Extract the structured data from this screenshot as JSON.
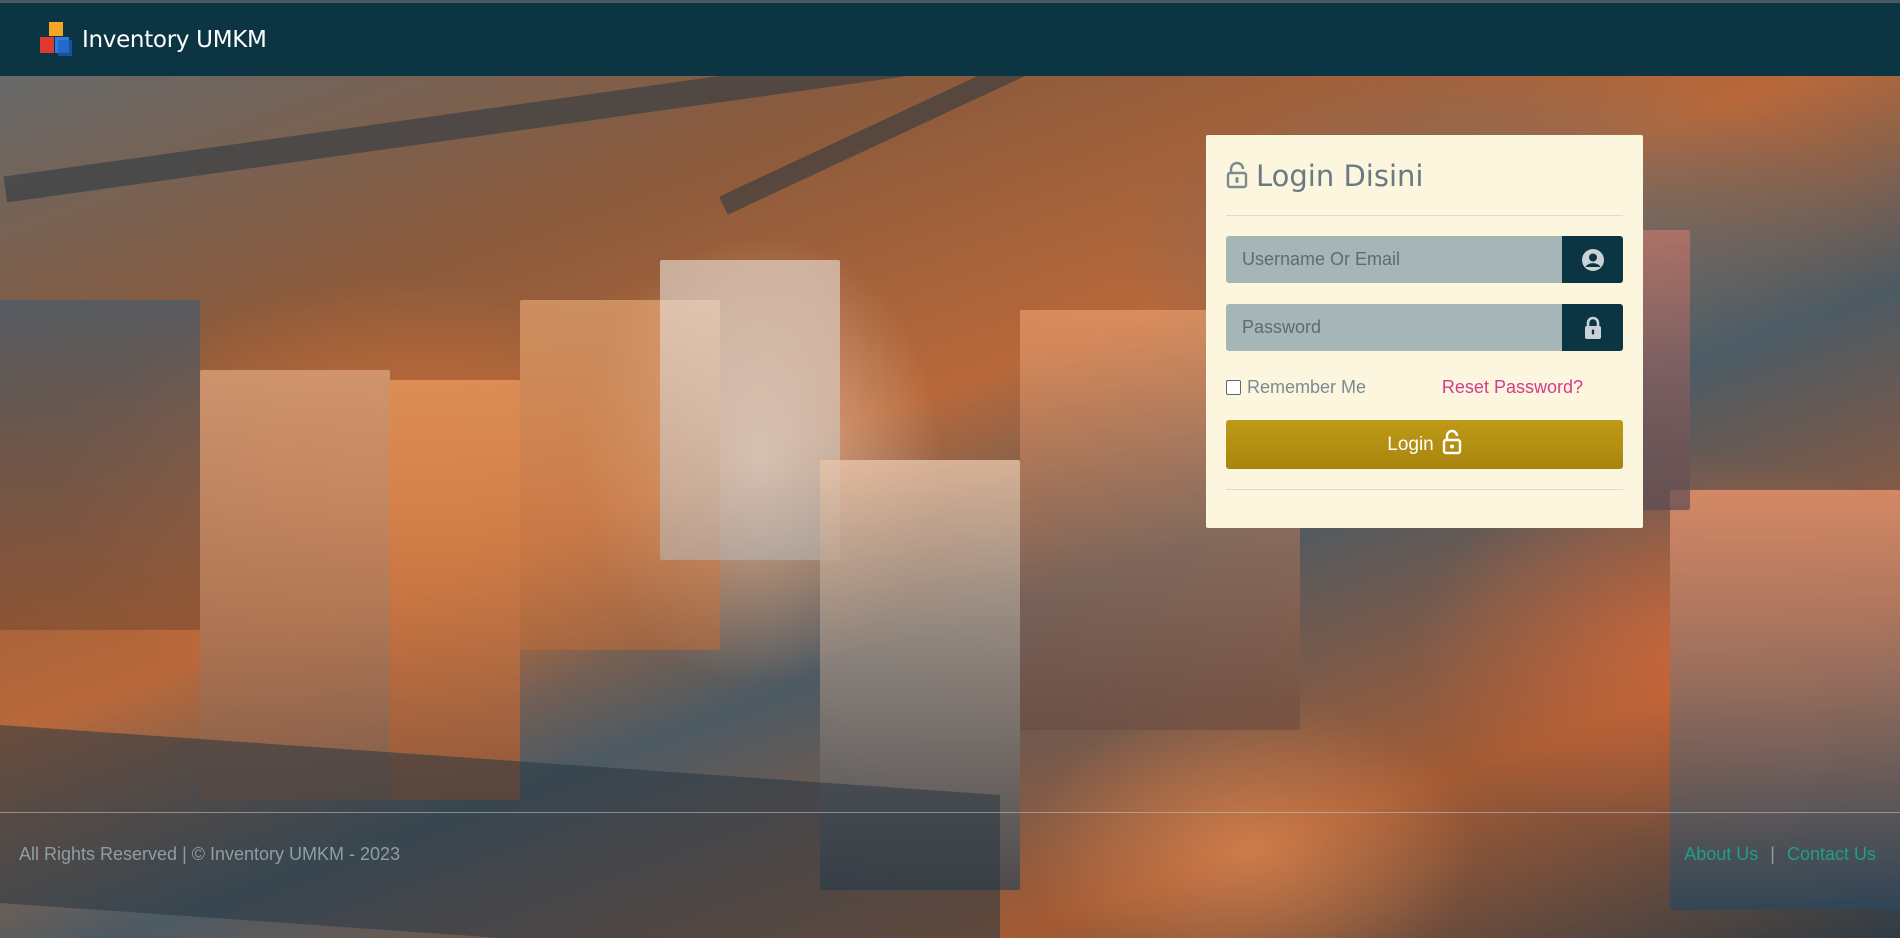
{
  "brand": {
    "title": "Inventory UMKM",
    "logo_icon": "cube-blocks-icon"
  },
  "login": {
    "heading": "Login Disini",
    "username_placeholder": "Username Or Email",
    "password_placeholder": "Password",
    "remember_label": "Remember Me",
    "reset_label": "Reset Password?",
    "submit_label": "Login"
  },
  "footer": {
    "copyright": "All Rights Reserved | © Inventory UMKM - 2023",
    "links": [
      "About Us",
      "Contact Us"
    ],
    "separator": "|"
  },
  "colors": {
    "navbar": "#0c3543",
    "card": "#fdf6df",
    "input": "#a6b6b6",
    "accent_button": "#b8940f",
    "reset_link": "#d23c8c",
    "footer_link": "#1f9f86"
  }
}
